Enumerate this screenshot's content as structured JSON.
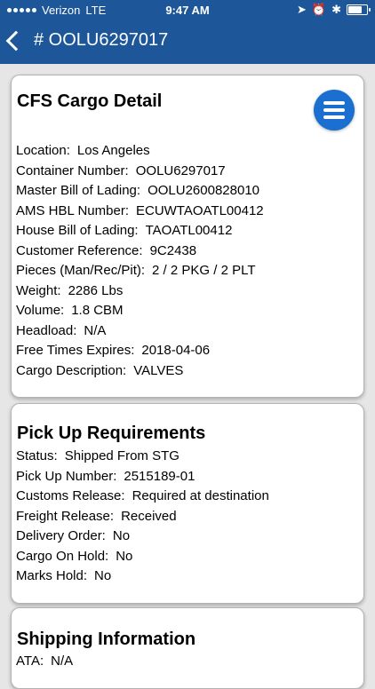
{
  "status_bar": {
    "carrier": "Verizon",
    "network": "LTE",
    "time": "9:47 AM"
  },
  "nav": {
    "title": "# OOLU6297017"
  },
  "cargo_detail": {
    "title": "CFS Cargo Detail",
    "rows": [
      {
        "label": "Location:",
        "value": "Los Angeles"
      },
      {
        "label": "Container Number:",
        "value": "OOLU6297017"
      },
      {
        "label": "Master Bill of Lading:",
        "value": "OOLU2600828010"
      },
      {
        "label": "AMS HBL Number:",
        "value": "ECUWTAOATL00412"
      },
      {
        "label": "House Bill of Lading:",
        "value": "TAOATL00412"
      },
      {
        "label": "Customer Reference:",
        "value": "9C2438"
      },
      {
        "label": "Pieces (Man/Rec/Pit):",
        "value": "2 / 2 PKG / 2 PLT"
      },
      {
        "label": "Weight:",
        "value": "2286 Lbs"
      },
      {
        "label": "Volume:",
        "value": "1.8 CBM"
      },
      {
        "label": "Headload:",
        "value": "N/A"
      },
      {
        "label": "Free Times Expires:",
        "value": "2018-04-06"
      },
      {
        "label": "Cargo Description:",
        "value": "VALVES"
      }
    ]
  },
  "pickup": {
    "title": "Pick Up Requirements",
    "rows": [
      {
        "label": "Status:",
        "value": "Shipped From STG"
      },
      {
        "label": "Pick Up Number:",
        "value": "2515189-01"
      },
      {
        "label": "Customs Release:",
        "value": "Required at destination"
      },
      {
        "label": "Freight Release:",
        "value": "Received"
      },
      {
        "label": "Delivery Order:",
        "value": "No"
      },
      {
        "label": "Cargo On Hold:",
        "value": "No"
      },
      {
        "label": "Marks Hold:",
        "value": "No"
      }
    ]
  },
  "shipping": {
    "title": "Shipping Information",
    "rows": [
      {
        "label": "ATA:",
        "value": "N/A"
      }
    ]
  }
}
